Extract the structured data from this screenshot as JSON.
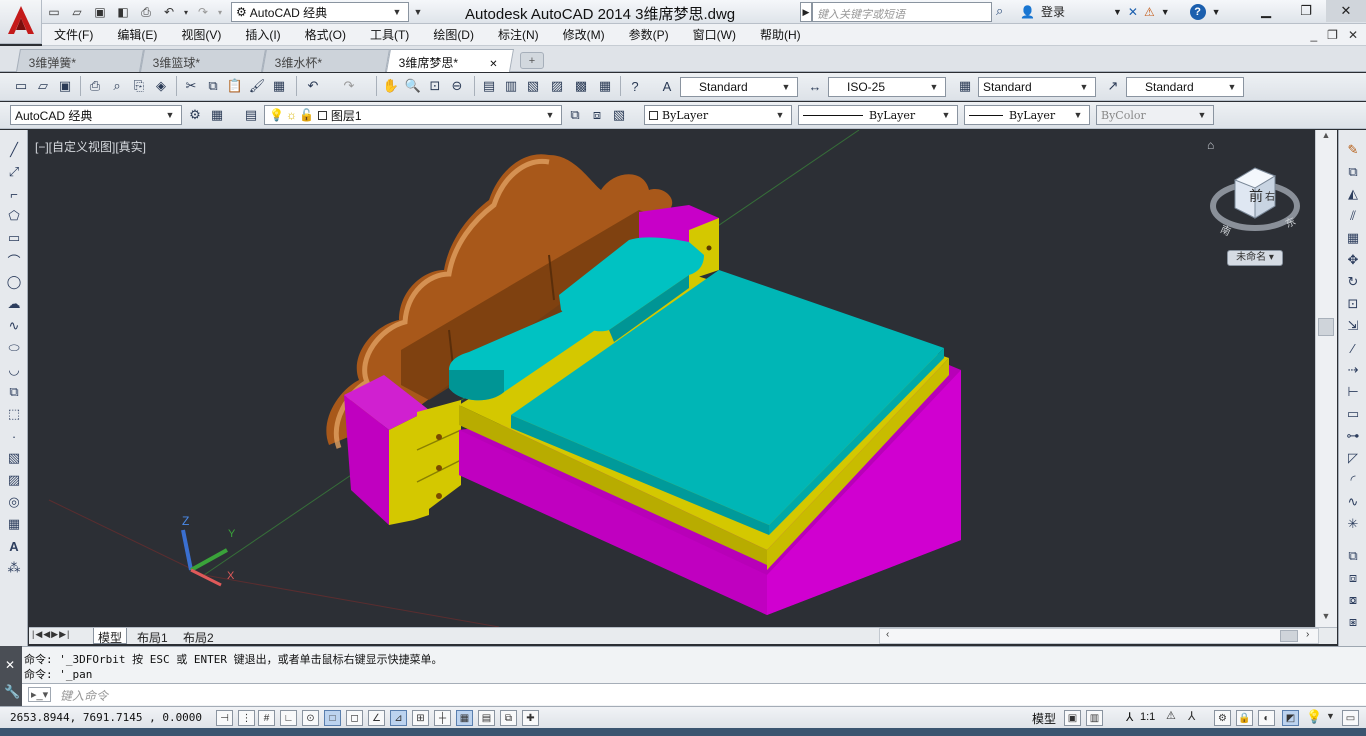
{
  "window": {
    "title": "Autodesk AutoCAD 2014    3维席梦思.dwg",
    "workspace": "AutoCAD 经典",
    "search_placeholder": "键入关键字或短语",
    "login": "登录",
    "help": "?"
  },
  "menu": {
    "items": [
      "文件(F)",
      "编辑(E)",
      "视图(V)",
      "插入(I)",
      "格式(O)",
      "工具(T)",
      "绘图(D)",
      "标注(N)",
      "修改(M)",
      "参数(P)",
      "窗口(W)",
      "帮助(H)"
    ]
  },
  "doc_tabs": [
    {
      "label": "3维弹簧*"
    },
    {
      "label": "3维篮球*"
    },
    {
      "label": "3维水杯*"
    },
    {
      "label": "3维席梦思*",
      "active": true
    }
  ],
  "styles_toolbar": {
    "text_style": "Standard",
    "dim_style": "ISO-25",
    "table_style": "Standard",
    "mleader_style": "Standard"
  },
  "layers_toolbar": {
    "workspace": "AutoCAD 经典",
    "layer": "图层1",
    "color": "ByLayer",
    "linetype": "ByLayer",
    "lineweight": "ByLayer",
    "plotstyle": "ByColor"
  },
  "viewport": {
    "label": "[−][自定义视图][真实]",
    "viewcube_face": "前",
    "viewcube_right": "右",
    "viewcube_compass_s": "南",
    "viewcube_compass_e": "东",
    "ucs_menu": "未命名 ▾",
    "axis_x": "X",
    "axis_y": "Y",
    "axis_z": "Z",
    "colors": {
      "headboard": "#b5651d",
      "frame": "#c800c8",
      "mattress": "#00b4b4",
      "trim": "#d4c800"
    }
  },
  "layout_tabs": [
    {
      "label": "模型",
      "active": true
    },
    {
      "label": "布局1"
    },
    {
      "label": "布局2"
    }
  ],
  "command": {
    "line1": "命令: '_3DFOrbit 按 ESC 或 ENTER 键退出，或者单击鼠标右键显示快捷菜单。",
    "line2": "命令: '_pan",
    "input_placeholder": "键入命令"
  },
  "status": {
    "coords": "2653.8944,  7691.7145 , 0.0000",
    "model_label": "模型",
    "anno_scale": "1:1"
  }
}
